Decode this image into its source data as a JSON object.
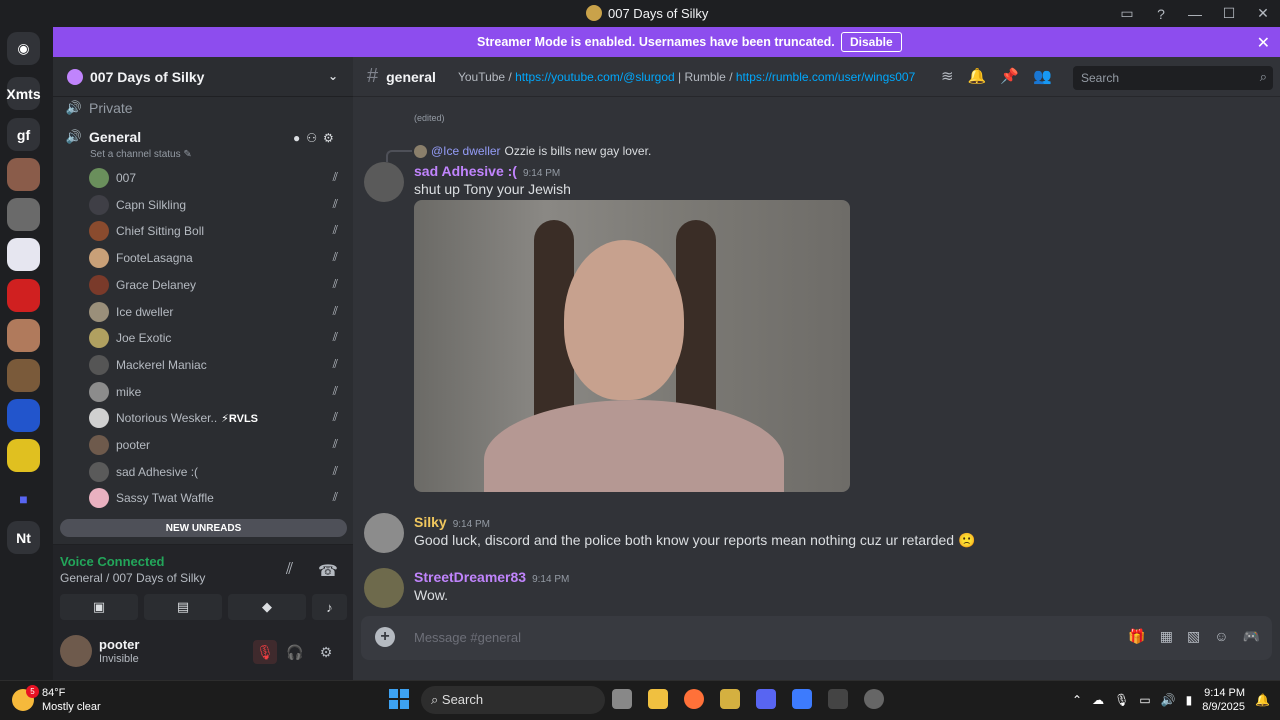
{
  "window": {
    "title": "007 Days of Silky"
  },
  "banner": {
    "text": "Streamer Mode is enabled. Usernames have been truncated.",
    "disable_label": "Disable"
  },
  "guilds": {
    "items": [
      "Xmts",
      "gf",
      "Nt"
    ]
  },
  "sidebar": {
    "server_name": "007 Days of Silky",
    "channels": {
      "private": "Private",
      "general": "General"
    },
    "channel_status": "Set a channel status",
    "members": [
      {
        "name": "007",
        "color": "#6a8f5c"
      },
      {
        "name": "Capn Silkling",
        "color": "#3f3f46"
      },
      {
        "name": "Chief Sitting Boll",
        "color": "#8a4b2e"
      },
      {
        "name": "FooteLasagna",
        "color": "#c9a078"
      },
      {
        "name": "Grace Delaney",
        "color": "#7a3a2a"
      },
      {
        "name": "Ice dweller",
        "color": "#9a8f7a"
      },
      {
        "name": "Joe Exotic",
        "color": "#b0a060"
      },
      {
        "name": "Mackerel Maniac",
        "color": "#555"
      },
      {
        "name": "mike",
        "color": "#8c8c8c"
      },
      {
        "name": "Notorious Wesker..",
        "color": "#d0d0d0",
        "badge": "⚡RVLS"
      },
      {
        "name": "pooter",
        "color": "#6e5a4c"
      },
      {
        "name": "sad Adhesive :(",
        "color": "#5a5a5a"
      },
      {
        "name": "Sassy Twat Waffle",
        "color": "#e9b1c0"
      }
    ],
    "new_unreads": "NEW UNREADS",
    "voice": {
      "status": "Voice Connected",
      "channel": "General / 007 Days of Silky"
    },
    "user": {
      "name": "pooter",
      "status": "Invisible"
    }
  },
  "channel": {
    "name": "general",
    "topic_prefix": "YouTube / ",
    "youtube": "https://youtube.com/@slurgod",
    "topic_mid": " | Rumble / ",
    "rumble": "https://rumble.com/user/wings007",
    "search_placeholder": "Search"
  },
  "messages": {
    "edited": "(edited)",
    "reply": {
      "mention": "@Ice dweller",
      "text": "Ozzie is bills new gay lover."
    },
    "m1": {
      "author": "sad Adhesive :(",
      "time": "9:14 PM",
      "text": "shut up Tony your Jewish",
      "color": "#c084fc"
    },
    "m2": {
      "author": "Silky",
      "time": "9:14 PM",
      "text": "Good luck, discord and the police both know your reports mean nothing cuz ur retarded",
      "emoji": "🙁",
      "color": "#f0c75e"
    },
    "m3": {
      "author": "StreetDreamer83",
      "time": "9:14 PM",
      "text": "Wow.",
      "color": "#c084fc"
    }
  },
  "composer": {
    "placeholder": "Message #general"
  },
  "taskbar": {
    "weather_temp": "84°F",
    "weather_desc": "Mostly clear",
    "weather_badge": "5",
    "search": "Search",
    "time": "9:14 PM",
    "date": "8/9/2025"
  }
}
